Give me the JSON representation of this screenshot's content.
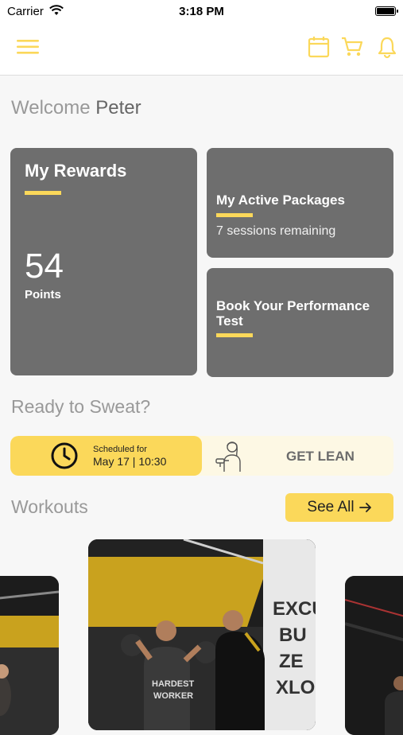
{
  "status_bar": {
    "carrier": "Carrier",
    "time": "3:18 PM"
  },
  "header": {
    "icons": [
      "menu-icon",
      "calendar-icon",
      "cart-icon",
      "bell-icon"
    ]
  },
  "welcome": {
    "greeting": "Welcome",
    "name": "Peter"
  },
  "rewards": {
    "title": "My Rewards",
    "points": "54",
    "points_label": "Points"
  },
  "packages": {
    "title": "My Active Packages",
    "subtitle": "7 sessions remaining"
  },
  "performance": {
    "title": "Book Your Performance Test"
  },
  "ready": {
    "title": "Ready to Sweat?",
    "scheduled_label": "Scheduled for",
    "scheduled_date": "May 17 | 10:30",
    "program": "GET LEAN"
  },
  "workouts": {
    "title": "Workouts",
    "see_all": "See All",
    "see_all_icon": "arrow-right-icon"
  },
  "colors": {
    "accent": "#fbd85a",
    "card": "#6e6e6e",
    "background": "#f7f7f7"
  }
}
